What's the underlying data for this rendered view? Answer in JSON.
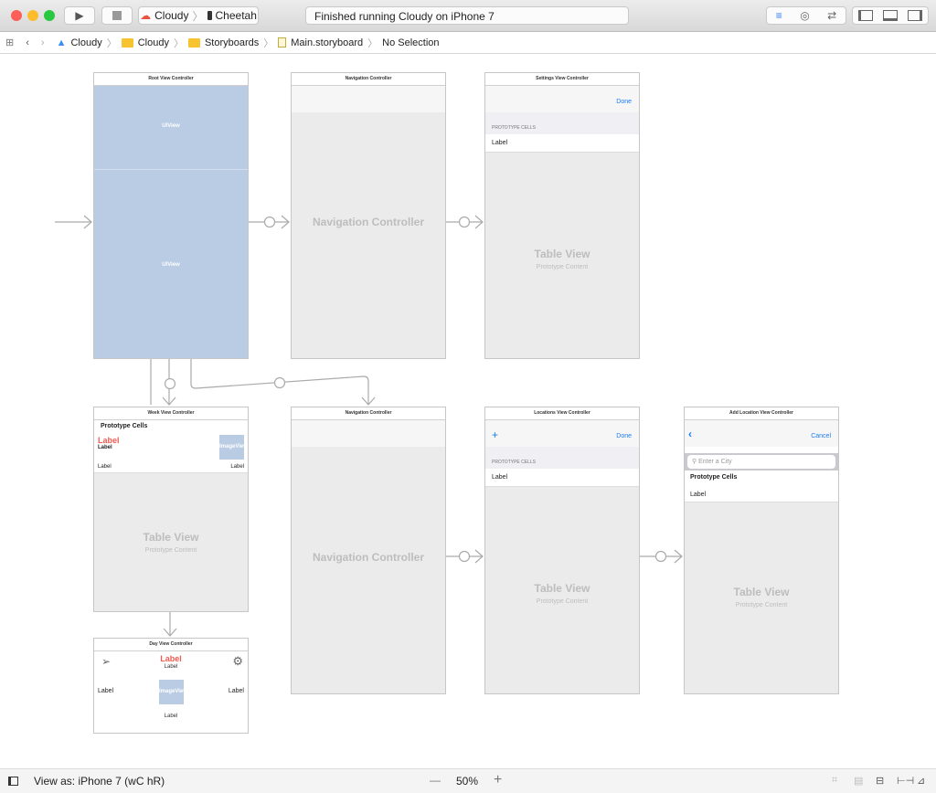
{
  "toolbar": {
    "scheme": "Cloudy",
    "device": "Cheetah",
    "status": "Finished running Cloudy on iPhone 7"
  },
  "jumpbar": {
    "items": [
      "Cloudy",
      "Cloudy",
      "Storyboards",
      "Main.storyboard",
      "No Selection"
    ]
  },
  "scenes": {
    "root": {
      "title": "Root View Controller",
      "top_view": "UIView",
      "bottom_view": "UIView"
    },
    "nav1": {
      "title": "Navigation Controller",
      "body": "Navigation Controller"
    },
    "settings": {
      "title": "Settings View Controller",
      "done": "Done",
      "section": "PROTOTYPE CELLS",
      "cell": "Label",
      "table": "Table View",
      "content": "Prototype Content"
    },
    "week": {
      "title": "Week View Controller",
      "header": "Prototype Cells",
      "red_label": "Label",
      "bold_label": "Label",
      "image": "ImageView",
      "left_label": "Label",
      "right_label": "Label",
      "table": "Table View",
      "content": "Prototype Content"
    },
    "nav2": {
      "title": "Navigation Controller",
      "body": "Navigation Controller"
    },
    "locations": {
      "title": "Locations View Controller",
      "add": "+",
      "done": "Done",
      "section": "PROTOTYPE CELLS",
      "cell": "Label",
      "table": "Table View",
      "content": "Prototype Content"
    },
    "addloc": {
      "title": "Add Location View Controller",
      "cancel": "Cancel",
      "search_placeholder": "Enter a City",
      "header": "Prototype Cells",
      "cell": "Label",
      "table": "Table View",
      "content": "Prototype Content"
    },
    "day": {
      "title": "Day View Controller",
      "red_label": "Label",
      "sub_label": "Label",
      "left_label": "Label",
      "right_label": "Label",
      "image": "ImageView",
      "bottom_label": "Label"
    }
  },
  "bottombar": {
    "view_as": "View as: iPhone 7 (wC hR)",
    "zoom": "50%",
    "minus": "—",
    "plus": "+"
  },
  "colors": {
    "accent": "#1a7cf4",
    "red": "#f05a4f",
    "view_blue": "#b9cce4"
  }
}
